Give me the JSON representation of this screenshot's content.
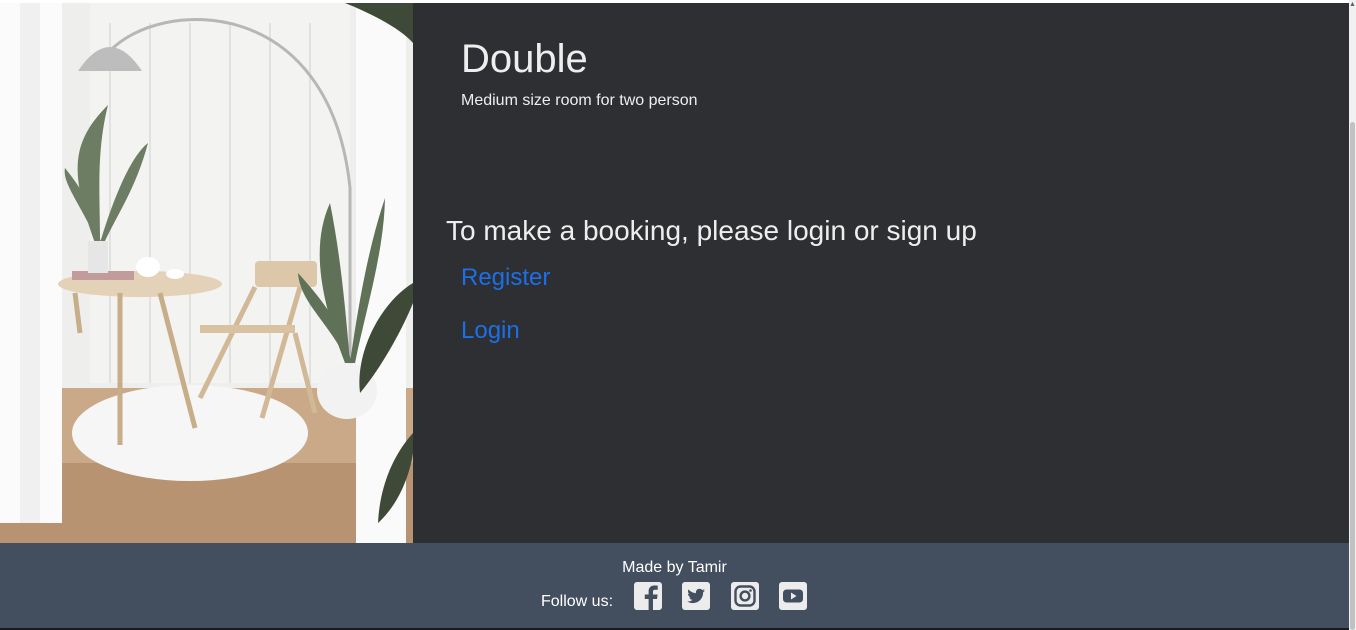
{
  "room": {
    "title": "Double",
    "description": "Medium size room for two person"
  },
  "booking": {
    "prompt": "To make a booking, please login or sign up",
    "register_label": "Register",
    "login_label": "Login"
  },
  "footer": {
    "made_by": "Made by Tamir",
    "follow_label": "Follow us:",
    "social_icons": [
      "facebook-icon",
      "twitter-icon",
      "instagram-icon",
      "youtube-icon"
    ]
  },
  "colors": {
    "panel_bg": "#2e2f32",
    "footer_bg": "#434e5e",
    "link": "#1c6fe8",
    "text_light": "#eeeeee"
  }
}
